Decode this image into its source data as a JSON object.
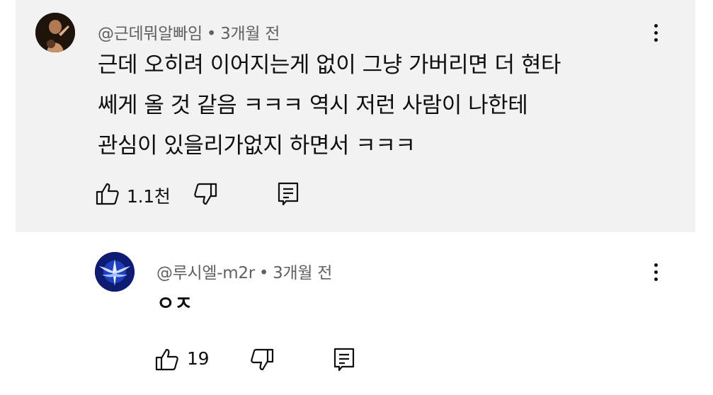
{
  "comments": [
    {
      "handle": "@근데뭐알빠임",
      "separator": "•",
      "time": "3개월 전",
      "lines": [
        "근데 오히려 이어지는게 없이 그냥 가버리면 더 현타",
        "쎄게 올 것 같음 ㅋㅋㅋ 역시 저런 사람이 나한테",
        "관심이 있을리가없지 하면서 ㅋㅋㅋ"
      ],
      "like_count": "1.1천"
    },
    {
      "handle": "@루시엘-m2r",
      "separator": "•",
      "time": "3개월 전",
      "lines": [
        "ㅇㅈ"
      ],
      "like_count": "19"
    }
  ],
  "icons": {
    "like": "thumbs-up-icon",
    "dislike": "thumbs-down-icon",
    "reply": "reply-icon",
    "menu": "more-vert-icon"
  },
  "colors": {
    "highlight_bg": "#f2f2f2",
    "meta_text": "#606060",
    "primary_text": "#0f0f0f"
  }
}
